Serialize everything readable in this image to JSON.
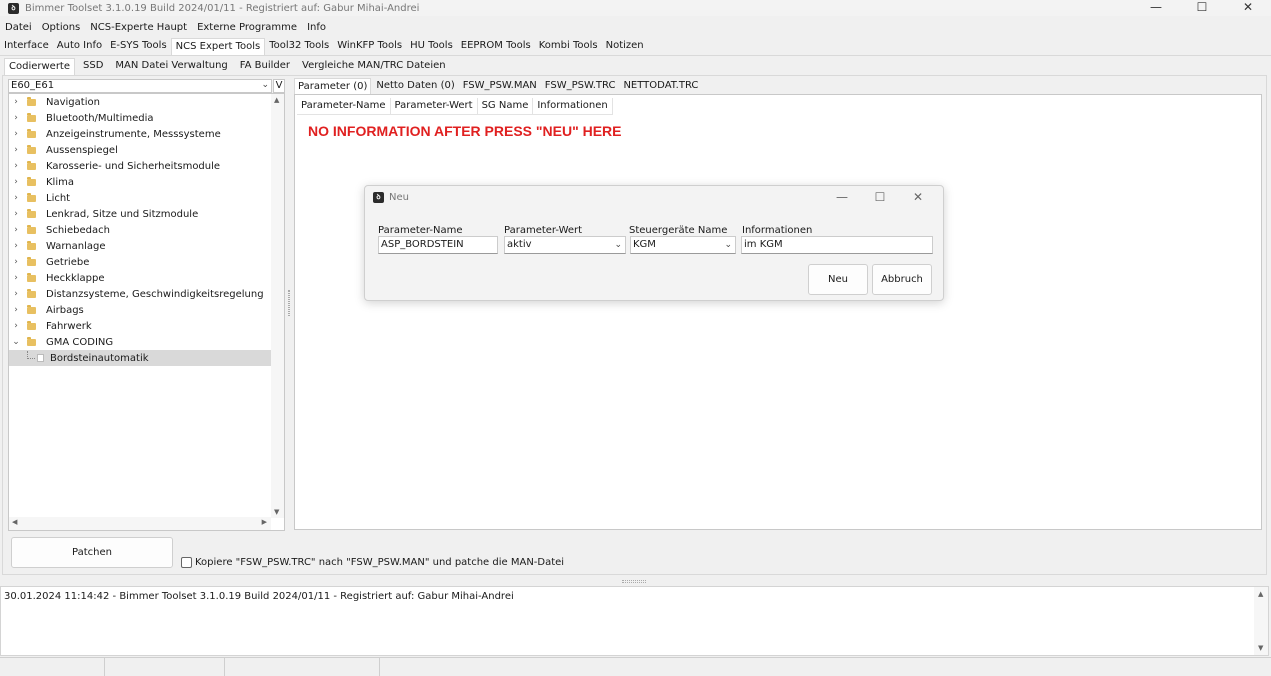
{
  "window": {
    "title": "Bimmer Toolset 3.1.0.19 Build 2024/01/11 - Registriert auf: Gabur Mihai-Andrei",
    "controls": [
      "—",
      "☐",
      "✕"
    ]
  },
  "menu": [
    "Datei",
    "Options",
    "NCS-Experte Haupt",
    "Externe Programme",
    "Info"
  ],
  "main_tabs": [
    "Interface",
    "Auto Info",
    "E-SYS Tools",
    "NCS Expert Tools",
    "Tool32 Tools",
    "WinKFP Tools",
    "HU Tools",
    "EEPROM Tools",
    "Kombi Tools",
    "Notizen"
  ],
  "sub_tabs": [
    "Codierwerte",
    "SSD",
    "MAN Datei Verwaltung",
    "FA Builder",
    "Vergleiche MAN/TRC Dateien"
  ],
  "model_select": {
    "value": "E60_E61",
    "v_button": "V"
  },
  "tree": {
    "folders": [
      "Navigation",
      "Bluetooth/Multimedia",
      "Anzeigeinstrumente, Messsysteme",
      "Aussenspiegel",
      "Karosserie- und Sicherheitsmodule",
      "Klima",
      "Licht",
      "Lenkrad, Sitze und Sitzmodule",
      "Schiebedach",
      "Warnanlage",
      "Getriebe",
      "Heckklappe",
      "Distanzsysteme, Geschwindigkeitsregelung",
      "Airbags",
      "Fahrwerk",
      "GMA CODING"
    ],
    "child": "Bordsteinautomatik"
  },
  "right_tabs": [
    "Parameter (0)",
    "Netto Daten (0)",
    "FSW_PSW.MAN",
    "FSW_PSW.TRC",
    "NETTODAT.TRC"
  ],
  "grid_headers": [
    "Parameter-Name",
    "Parameter-Wert",
    "SG Name",
    "Informationen"
  ],
  "warning_text": "NO INFORMATION AFTER PRESS \"NEU\" HERE",
  "dialog": {
    "title": "Neu",
    "fields": {
      "name_label": "Parameter-Name",
      "name_value": "ASP_BORDSTEIN",
      "wert_label": "Parameter-Wert",
      "wert_value": "aktiv",
      "sg_label": "Steuergeräte Name",
      "sg_value": "KGM",
      "info_label": "Informationen",
      "info_value": "im KGM"
    },
    "ok_label": "Neu",
    "cancel_label": "Abbruch"
  },
  "patch_button": "Patchen",
  "checkbox_label": "Kopiere \"FSW_PSW.TRC\" nach \"FSW_PSW.MAN\" und patche die MAN-Datei",
  "log_line": "30.01.2024 11:14:42 - Bimmer Toolset 3.1.0.19 Build 2024/01/11 - Registriert auf: Gabur Mihai-Andrei",
  "colors": {
    "warning": "#e02020",
    "folder": "#e8c061"
  }
}
